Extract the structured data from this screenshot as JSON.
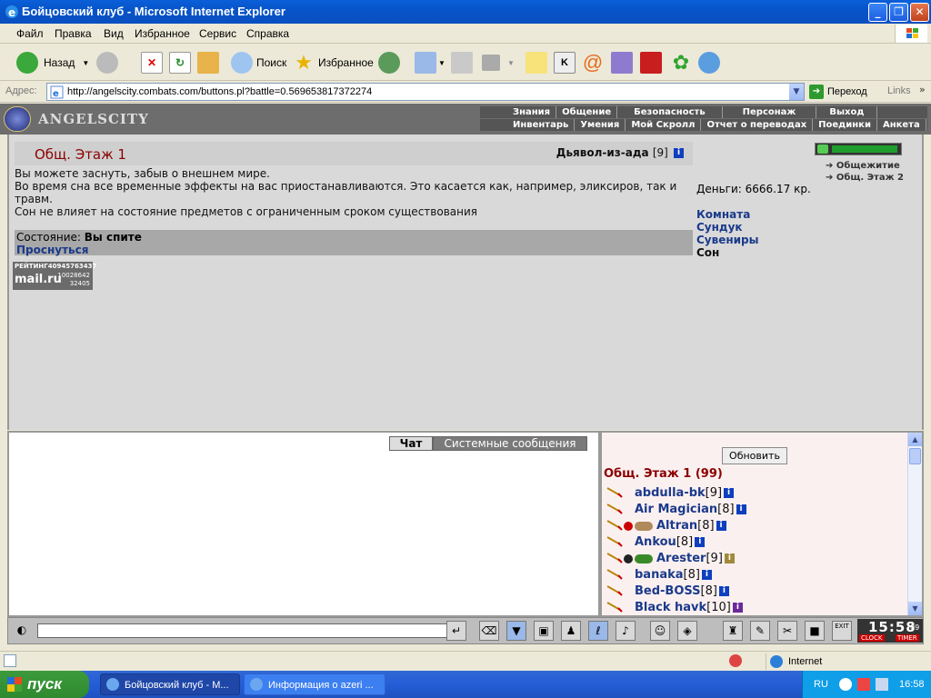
{
  "window": {
    "title": "Бойцовский клуб - Microsoft Internet Explorer"
  },
  "menu": [
    "Файл",
    "Правка",
    "Вид",
    "Избранное",
    "Сервис",
    "Справка"
  ],
  "toolbar": {
    "back_label": "Назад",
    "search_label": "Поиск",
    "favorites_label": "Избранное"
  },
  "address": {
    "label": "Адрес:",
    "url": "http://angelscity.combats.com/buttons.pl?battle=0.569653817372274",
    "go_label": "Переход",
    "links_label": "Links"
  },
  "site": {
    "logo_text": "ANGELSCITY",
    "nav_top": [
      "Знания",
      "Общение",
      "Безопасность",
      "Персонаж",
      "Выход"
    ],
    "nav_bottom": [
      "Инвентарь",
      "Умения",
      "Мой Скролл",
      "Отчет о переводах",
      "Поединки",
      "Анкета"
    ]
  },
  "room": {
    "title": "Общ. Этаж 1",
    "player_name": "Дьявол-из-ада",
    "player_level": "[9]",
    "desc_1": "Вы можете заснуть, забыв о внешнем мире.",
    "desc_2": "Во время сна все временные эффекты на вас приостанавливаются. Это касается как, например, эликсиров, так и травм.",
    "desc_3": "Сон не влияет на состояние предметов с ограниченным сроком существования",
    "status_label": "Состояние:",
    "status_value": "Вы спите",
    "wake_link": "Проснуться",
    "money_label": "Деньги: 6666.17 кр.",
    "links": [
      "Комната",
      "Сундук",
      "Сувениры",
      "Сон"
    ],
    "map_links": [
      "Общежитие",
      "Общ. Этаж 2"
    ]
  },
  "counter": {
    "r1": "РЕЙТИНГ",
    "n1": "40945763437",
    "n2": "10028642",
    "n3": "32405",
    "mail": "mail.ru"
  },
  "chat": {
    "tab_chat": "Чат",
    "tab_system": "Системные сообщения"
  },
  "users": {
    "refresh_label": "Обновить",
    "room_count": "Общ. Этаж 1 (99)",
    "list": [
      {
        "name": "abdulla-bk",
        "level": "[9]"
      },
      {
        "name": "Air Magician",
        "level": "[8]"
      },
      {
        "name": "Altran",
        "level": "[8]"
      },
      {
        "name": "Ankou",
        "level": "[8]"
      },
      {
        "name": "Arester",
        "level": "[9]"
      },
      {
        "name": "banaka",
        "level": "[8]"
      },
      {
        "name": "Bed-BOSS",
        "level": "[8]"
      },
      {
        "name": "Black havk",
        "level": "[10]"
      }
    ]
  },
  "clock": {
    "time": "15:58",
    "seconds": "09",
    "clock_label": "CLOCK",
    "timer_label": "TIMER",
    "exit_label": "EXIT"
  },
  "ie_status": {
    "zone": "Internet"
  },
  "taskbar": {
    "start_label": "пуск",
    "task_1": "Бойцовский клуб - М...",
    "task_2": "Информация о azeri ...",
    "lang": "RU",
    "time": "16:58"
  },
  "colors": {
    "room_title": "#8b0000",
    "link": "#1a3a8a",
    "xp_blue": "#245dd6"
  }
}
